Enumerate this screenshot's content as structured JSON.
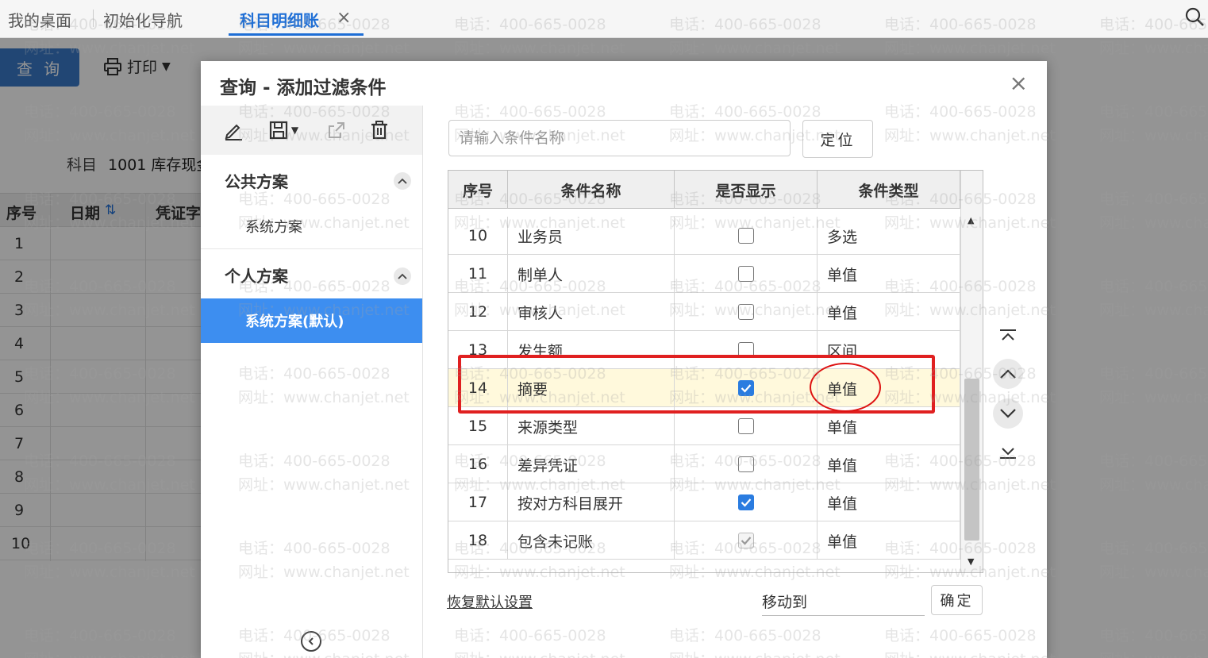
{
  "tabs": [
    {
      "label": "我的桌面"
    },
    {
      "label": "初始化导航"
    },
    {
      "label": "科目明细账",
      "active": true
    }
  ],
  "toolbar": {
    "query_label": "查 询",
    "print_label": "打印"
  },
  "subject": {
    "label": "科目",
    "value": "1001 库存现金"
  },
  "ledger_table": {
    "headers": [
      "序号",
      "日期",
      "凭证字"
    ],
    "rows": [
      "1",
      "2",
      "3",
      "4",
      "5",
      "6",
      "7",
      "8",
      "9",
      "10"
    ]
  },
  "dialog": {
    "title": "查询 - 添加过滤条件",
    "close_glyph": "×",
    "public_group_title": "公共方案",
    "public_plans": [
      "系统方案"
    ],
    "personal_group_title": "个人方案",
    "personal_plans": [
      "系统方案(默认)"
    ],
    "search_placeholder": "请输入条件名称",
    "locate_label": "定位",
    "columns": [
      "序号",
      "条件名称",
      "是否显示",
      "条件类型"
    ],
    "rows": [
      {
        "no": "10",
        "name": "业务员",
        "shown": false,
        "disabled": false,
        "type": "多选"
      },
      {
        "no": "11",
        "name": "制单人",
        "shown": false,
        "disabled": false,
        "type": "单值"
      },
      {
        "no": "12",
        "name": "审核人",
        "shown": false,
        "disabled": false,
        "type": "单值"
      },
      {
        "no": "13",
        "name": "发生额",
        "shown": false,
        "disabled": false,
        "type": "区间"
      },
      {
        "no": "14",
        "name": "摘要",
        "shown": true,
        "disabled": false,
        "type": "单值",
        "highlighted": true
      },
      {
        "no": "15",
        "name": "来源类型",
        "shown": false,
        "disabled": false,
        "type": "单值"
      },
      {
        "no": "16",
        "name": "差异凭证",
        "shown": false,
        "disabled": false,
        "type": "单值"
      },
      {
        "no": "17",
        "name": "按对方科目展开",
        "shown": true,
        "disabled": false,
        "type": "单值"
      },
      {
        "no": "18",
        "name": "包含未记账",
        "shown": true,
        "disabled": true,
        "type": "单值"
      }
    ],
    "restore_label": "恢复默认设置",
    "move_to_label": "移动到",
    "ok_label": "确定"
  },
  "watermark": {
    "phone": "电话：400-665-0028",
    "site": "网址：www.chanjet.net"
  },
  "colors": {
    "accent": "#1f6fd6",
    "selected_plan": "#3d8ef0",
    "checkbox_on": "#2a7ce0",
    "annotation": "#e02020",
    "row_highlight": "#fff9dc"
  }
}
